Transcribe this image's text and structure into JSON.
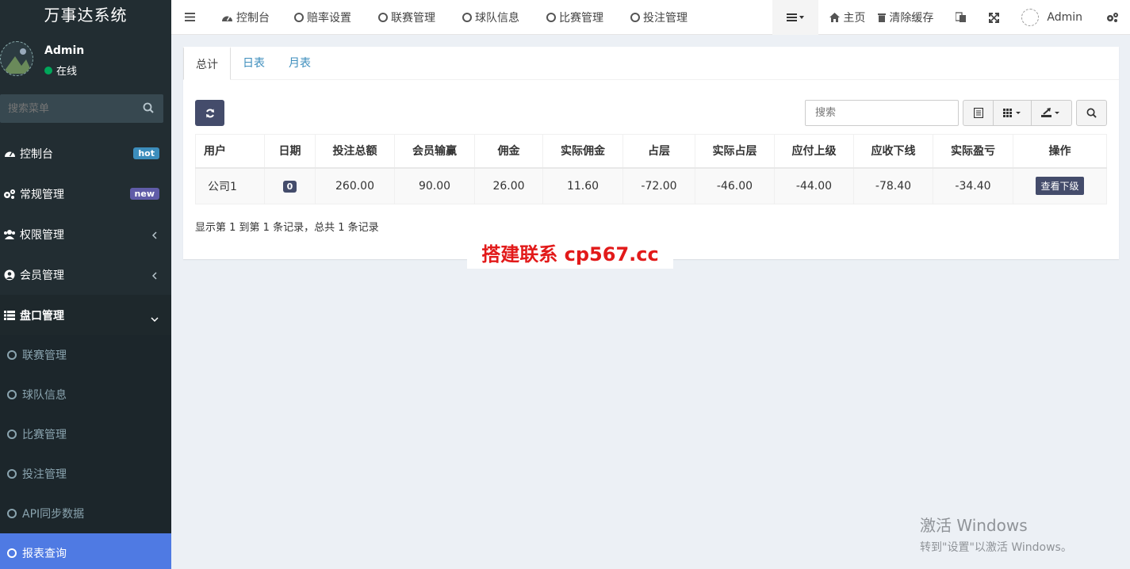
{
  "app": {
    "title": "万事达系统"
  },
  "user": {
    "name": "Admin",
    "status": "在线"
  },
  "sidebar": {
    "search_placeholder": "搜索菜单",
    "items": [
      {
        "label": "控制台",
        "badge": "hot"
      },
      {
        "label": "常规管理",
        "badge": "new"
      },
      {
        "label": "权限管理"
      },
      {
        "label": "会员管理"
      },
      {
        "label": "盘口管理"
      }
    ],
    "subitems": [
      {
        "label": "联赛管理"
      },
      {
        "label": "球队信息"
      },
      {
        "label": "比赛管理"
      },
      {
        "label": "投注管理"
      },
      {
        "label": "API同步数据"
      },
      {
        "label": "报表查询"
      }
    ]
  },
  "navbar": {
    "links": [
      {
        "label": "控制台"
      },
      {
        "label": "赔率设置"
      },
      {
        "label": "联赛管理"
      },
      {
        "label": "球队信息"
      },
      {
        "label": "比赛管理"
      },
      {
        "label": "投注管理"
      }
    ],
    "home": "主页",
    "clear_cache": "清除缓存",
    "user": "Admin"
  },
  "tabs": [
    {
      "label": "总计"
    },
    {
      "label": "日表"
    },
    {
      "label": "月表"
    }
  ],
  "table": {
    "search_placeholder": "搜索",
    "columns": [
      "用户",
      "日期",
      "投注总额",
      "会员输赢",
      "佣金",
      "实际佣金",
      "占层",
      "实际占层",
      "应付上级",
      "应收下线",
      "实际盈亏",
      "操作"
    ],
    "rows": [
      {
        "user": "公司1",
        "date": "0",
        "total_bet": "260.00",
        "member_win": "90.00",
        "commission": "26.00",
        "actual_commission": "11.60",
        "share": "-72.00",
        "actual_share": "-46.00",
        "pay_upper": "-44.00",
        "receive_lower": "-78.40",
        "actual_profit": "-34.40",
        "action": "查看下级"
      }
    ],
    "pager": "显示第 1 到第 1 条记录，总共 1 条记录"
  },
  "watermark": "搭建联系 cp567.cc",
  "windows_activation": {
    "line1": "激活 Windows",
    "line2": "转到\"设置\"以激活 Windows。"
  },
  "colors": {
    "sidebar_bg": "#222d32",
    "active_menu": "#4f7ae3",
    "accent_button": "#444c6b",
    "link": "#3c8dbc",
    "watermark": "#e21a1a"
  }
}
